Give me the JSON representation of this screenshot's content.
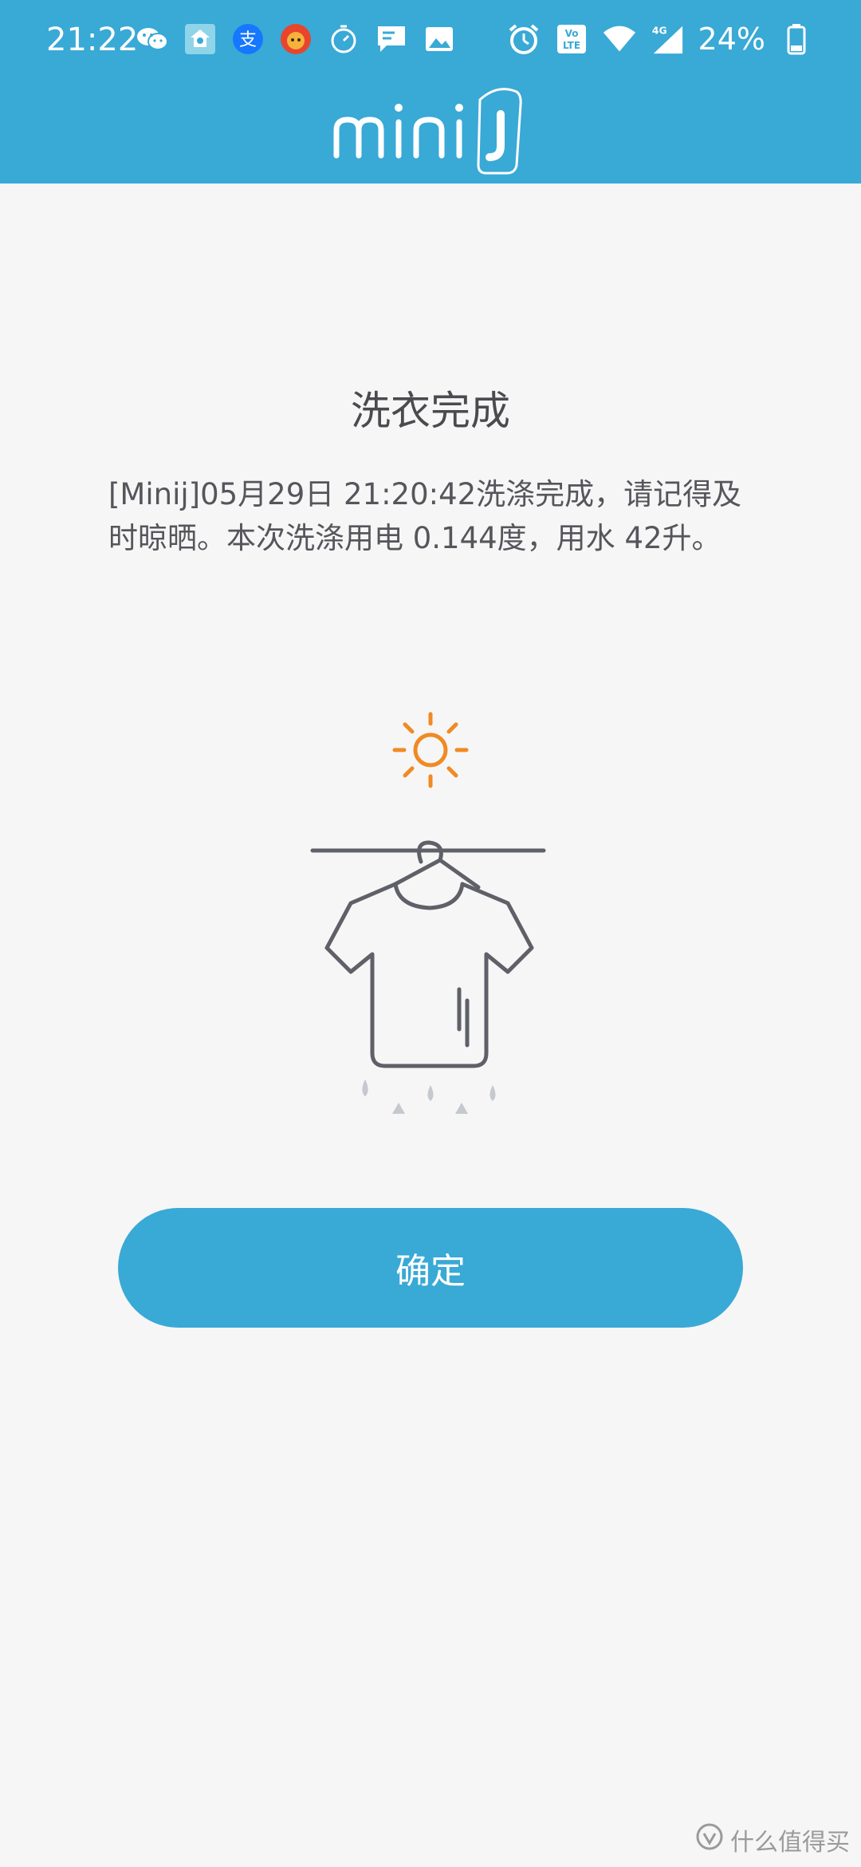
{
  "status_bar": {
    "time": "21:22",
    "battery": "24%",
    "network": "4G",
    "volte": "VoLTE",
    "left_icons": [
      "wechat-icon",
      "app-icon",
      "alipay-icon",
      "app-avatar-icon",
      "timer-icon",
      "message-icon",
      "gallery-icon"
    ],
    "right_icons": [
      "alarm-icon",
      "volte-icon",
      "wifi-icon",
      "signal-icon",
      "battery-icon"
    ]
  },
  "header": {
    "logo_text": "minij"
  },
  "dialog": {
    "title": "洗衣完成",
    "message": "[Minij]05月29日 21:20:42洗涤完成，请记得及\n时晾晒。本次洗涤用电 0.144度，用水 42升。"
  },
  "actions": {
    "confirm_label": "确定"
  },
  "watermark": {
    "text": "什么值得买"
  },
  "colors": {
    "primary": "#39a9d6",
    "sun": "#f08a24",
    "illustration": "#5f6068",
    "drops": "#c6c8cf"
  }
}
